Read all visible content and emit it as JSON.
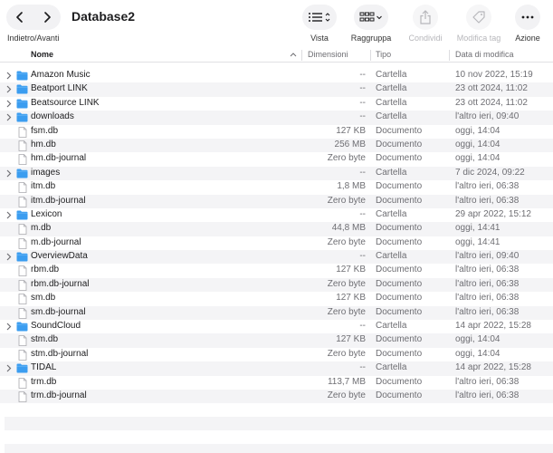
{
  "window": {
    "title": "Database2"
  },
  "nav": {
    "caption": "Indietro/Avanti"
  },
  "toolbar": {
    "view_label": "Vista",
    "group_label": "Raggruppa",
    "share_label": "Condividi",
    "tags_label": "Modifica tag",
    "action_label": "Azione"
  },
  "columns": {
    "name": "Nome",
    "size": "Dimensioni",
    "kind": "Tipo",
    "date": "Data di modifica"
  },
  "rows": [
    {
      "name": "Amazon Music",
      "size": "--",
      "kind": "Cartella",
      "date": "10 nov 2022, 15:19",
      "folder": true
    },
    {
      "name": "Beatport LINK",
      "size": "--",
      "kind": "Cartella",
      "date": "23 ott 2024, 11:02",
      "folder": true
    },
    {
      "name": "Beatsource LINK",
      "size": "--",
      "kind": "Cartella",
      "date": "23 ott 2024, 11:02",
      "folder": true
    },
    {
      "name": "downloads",
      "size": "--",
      "kind": "Cartella",
      "date": "l'altro ieri, 09:40",
      "folder": true
    },
    {
      "name": "fsm.db",
      "size": "127 KB",
      "kind": "Documento",
      "date": "oggi, 14:04",
      "folder": false
    },
    {
      "name": "hm.db",
      "size": "256 MB",
      "kind": "Documento",
      "date": "oggi, 14:04",
      "folder": false
    },
    {
      "name": "hm.db-journal",
      "size": "Zero byte",
      "kind": "Documento",
      "date": "oggi, 14:04",
      "folder": false
    },
    {
      "name": "images",
      "size": "--",
      "kind": "Cartella",
      "date": "7 dic 2024, 09:22",
      "folder": true
    },
    {
      "name": "itm.db",
      "size": "1,8 MB",
      "kind": "Documento",
      "date": "l'altro ieri, 06:38",
      "folder": false
    },
    {
      "name": "itm.db-journal",
      "size": "Zero byte",
      "kind": "Documento",
      "date": "l'altro ieri, 06:38",
      "folder": false
    },
    {
      "name": "Lexicon",
      "size": "--",
      "kind": "Cartella",
      "date": "29 apr 2022, 15:12",
      "folder": true
    },
    {
      "name": "m.db",
      "size": "44,8 MB",
      "kind": "Documento",
      "date": "oggi, 14:41",
      "folder": false
    },
    {
      "name": "m.db-journal",
      "size": "Zero byte",
      "kind": "Documento",
      "date": "oggi, 14:41",
      "folder": false
    },
    {
      "name": "OverviewData",
      "size": "--",
      "kind": "Cartella",
      "date": "l'altro ieri, 09:40",
      "folder": true
    },
    {
      "name": "rbm.db",
      "size": "127 KB",
      "kind": "Documento",
      "date": "l'altro ieri, 06:38",
      "folder": false
    },
    {
      "name": "rbm.db-journal",
      "size": "Zero byte",
      "kind": "Documento",
      "date": "l'altro ieri, 06:38",
      "folder": false
    },
    {
      "name": "sm.db",
      "size": "127 KB",
      "kind": "Documento",
      "date": "l'altro ieri, 06:38",
      "folder": false
    },
    {
      "name": "sm.db-journal",
      "size": "Zero byte",
      "kind": "Documento",
      "date": "l'altro ieri, 06:38",
      "folder": false
    },
    {
      "name": "SoundCloud",
      "size": "--",
      "kind": "Cartella",
      "date": "14 apr 2022, 15:28",
      "folder": true
    },
    {
      "name": "stm.db",
      "size": "127 KB",
      "kind": "Documento",
      "date": "oggi, 14:04",
      "folder": false
    },
    {
      "name": "stm.db-journal",
      "size": "Zero byte",
      "kind": "Documento",
      "date": "oggi, 14:04",
      "folder": false
    },
    {
      "name": "TIDAL",
      "size": "--",
      "kind": "Cartella",
      "date": "14 apr 2022, 15:28",
      "folder": true
    },
    {
      "name": "trm.db",
      "size": "113,7 MB",
      "kind": "Documento",
      "date": "l'altro ieri, 06:38",
      "folder": false
    },
    {
      "name": "trm.db-journal",
      "size": "Zero byte",
      "kind": "Documento",
      "date": "l'altro ieri, 06:38",
      "folder": false
    }
  ],
  "icons": {
    "back": "chevron-left-icon",
    "forward": "chevron-right-icon",
    "view": "list-view-icon",
    "group": "grid-group-icon",
    "share": "share-icon",
    "tags": "tag-icon",
    "action": "ellipsis-icon",
    "folder": "folder-icon",
    "document": "document-icon"
  },
  "colors": {
    "folder": "#3b9df0",
    "row_alt": "#f4f4f6",
    "text_secondary": "#6e6e73"
  }
}
